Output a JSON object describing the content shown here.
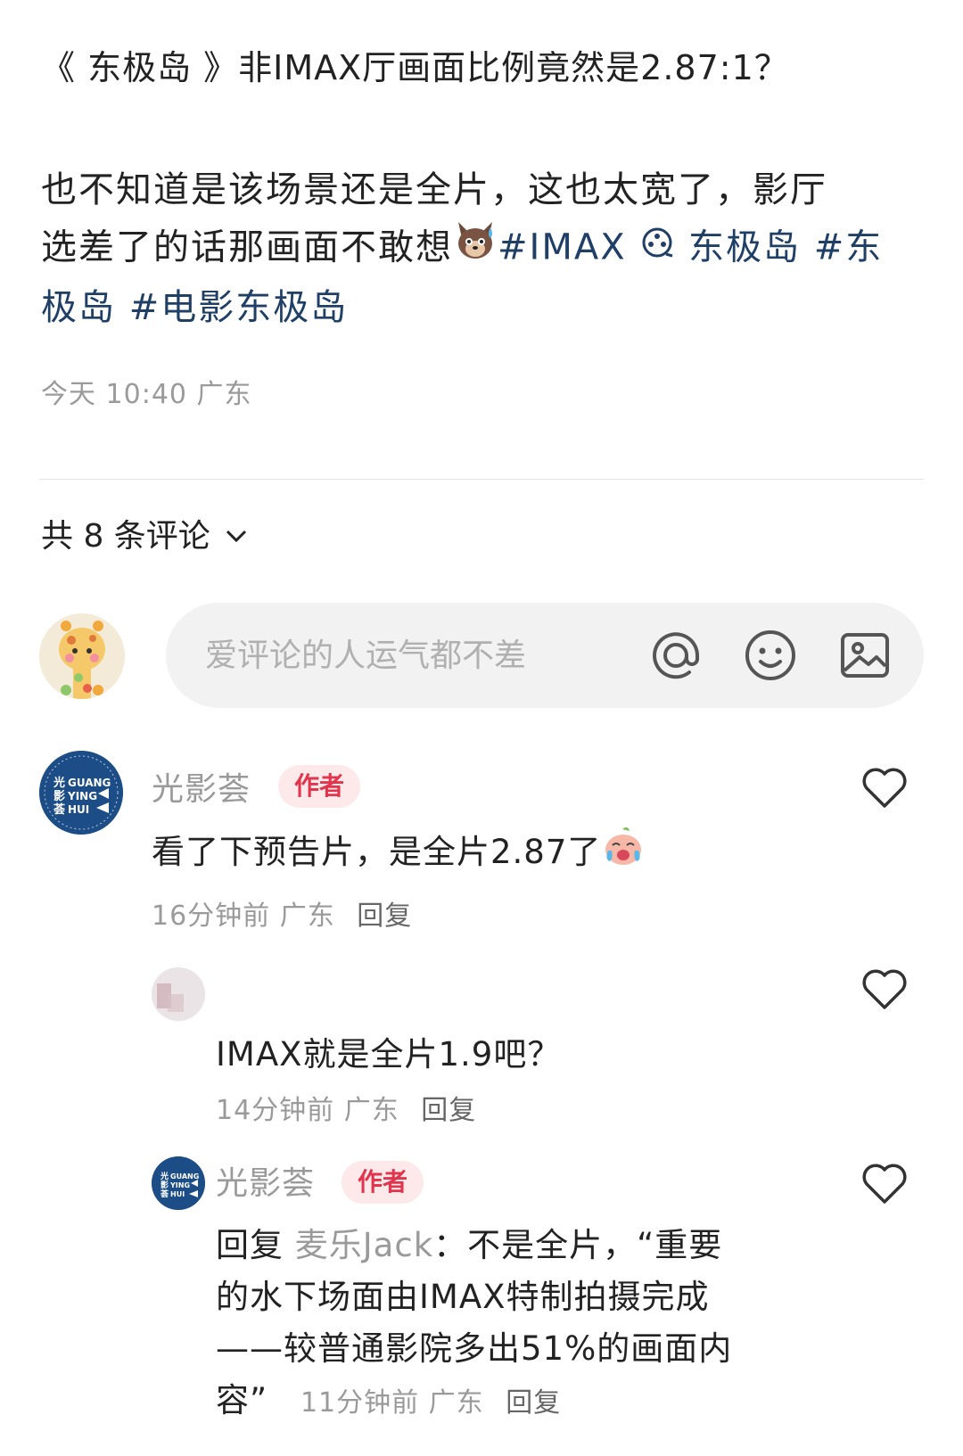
{
  "post": {
    "title": "《 东极岛 》非IMAX厅画面比例竟然是2.87:1？",
    "body_line1": "也不知道是该场景还是全片，这也太宽了，影厅",
    "body_line2_text": "选差了的话那画面不敢想",
    "tag1": "#IMAX",
    "tag2": "东极岛",
    "tag3_part1": "#东",
    "tag3_part2": "极岛",
    "tag4": "#电影东极岛",
    "meta": "今天 10:40 广东"
  },
  "comments_header": {
    "label": "共 8 条评论"
  },
  "comment_input": {
    "placeholder": "爱评论的人运气都不差"
  },
  "comments": [
    {
      "name": "光影荟",
      "badge": "作者",
      "text": "看了下预告片，是全片2.87了",
      "time": "16分钟前",
      "location": "广东",
      "reply": "回复"
    },
    {
      "name": "",
      "text": "IMAX就是全片1.9吧？",
      "time": "14分钟前",
      "location": "广东",
      "reply": "回复"
    },
    {
      "name": "光影荟",
      "badge": "作者",
      "reply_prefix": "回复",
      "reply_to": "麦乐Jack",
      "line1": "：不是全片，“重要",
      "line2": "的水下场面由IMAX特制拍摄完成",
      "line3": "——较普通影院多出51%的画面内",
      "line4": "容”",
      "time": "11分钟前",
      "location": "广东",
      "reply": "回复"
    }
  ],
  "brand_avatar": {
    "cn": "光影荟",
    "en1": "GUANG",
    "en2": "YING",
    "en3": "HUI"
  }
}
